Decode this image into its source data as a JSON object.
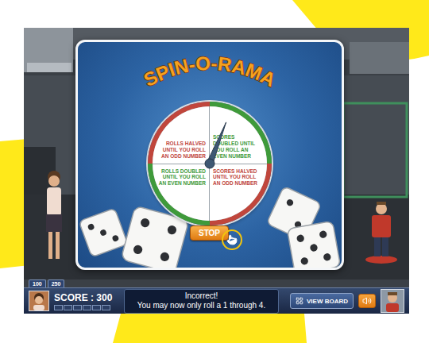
{
  "dialog": {
    "title": "SPIN-O-RAMA",
    "segments": [
      {
        "text": "ROLLS HALVED UNTIL YOU ROLL AN ODD NUMBER",
        "color": "#c0463c"
      },
      {
        "text": "SCORES DOUBLED UNTIL YOU ROLL AN EVEN NUMBER",
        "color": "#3f9a3a"
      },
      {
        "text": "ROLLS DOUBLED UNTIL YOU ROLL AN EVEN NUMBER",
        "color": "#3f9a3a"
      },
      {
        "text": "SCORES HALVED UNTIL YOU ROLL AN ODD NUMBER",
        "color": "#c0463c"
      }
    ],
    "needle": {
      "level": 0.06
    },
    "button": "STOP"
  },
  "hud": {
    "tabs": [
      {
        "label": "100",
        "selected": false
      },
      {
        "label": "250",
        "selected": false
      }
    ],
    "score": "SCORE : 300",
    "score_slots": [
      {
        "filled": false
      },
      {
        "filled": false
      },
      {
        "filled": false
      },
      {
        "filled": false
      },
      {
        "filled": false
      },
      {
        "filled": false
      }
    ],
    "message": [
      "Incorrect!",
      "You may now only roll a 1 through 4."
    ],
    "view_board": "VIEW BOARD",
    "sound": {
      "on": true
    }
  }
}
